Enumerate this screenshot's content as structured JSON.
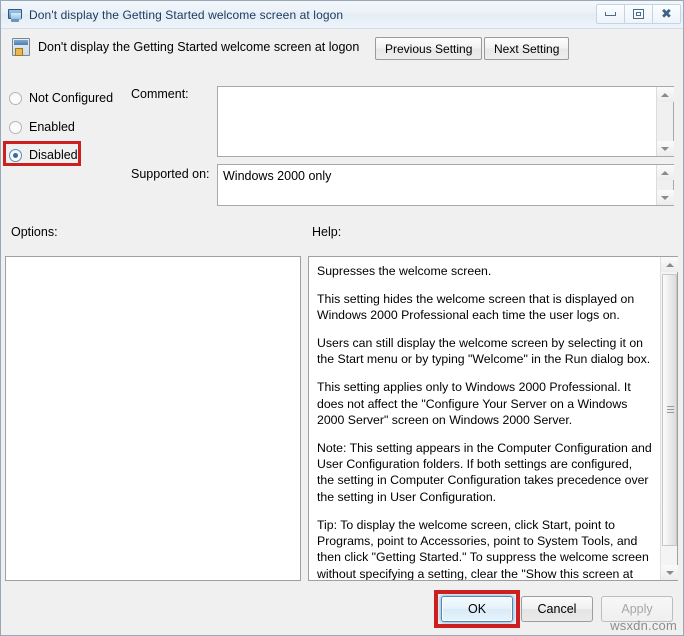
{
  "window": {
    "title": "Don't display the Getting Started welcome screen at logon",
    "title_icon": "monitor-icon",
    "controls": {
      "minimize": "minimize-icon",
      "restore": "restore-icon",
      "close": "close-icon"
    }
  },
  "header": {
    "icon": "policy-setting-icon",
    "title": "Don't display the Getting Started welcome screen at logon",
    "previous_label": "Previous Setting",
    "next_label": "Next Setting"
  },
  "state_options": [
    {
      "label": "Not Configured",
      "selected": false
    },
    {
      "label": "Enabled",
      "selected": false
    },
    {
      "label": "Disabled",
      "selected": true
    }
  ],
  "fields": {
    "comment_label": "Comment:",
    "comment_value": "",
    "supported_label": "Supported on:",
    "supported_value": "Windows 2000 only"
  },
  "panels": {
    "options_label": "Options:",
    "options_content": "",
    "help_label": "Help:",
    "help_paragraphs": [
      "Supresses the welcome screen.",
      "This setting hides the welcome screen that is displayed on Windows 2000 Professional each time the user logs on.",
      "Users can still display the welcome screen by selecting it on the Start menu or by typing \"Welcome\" in the Run dialog box.",
      "This setting applies only to Windows 2000 Professional. It does not affect the \"Configure Your Server on a Windows 2000 Server\" screen on Windows 2000 Server.",
      "Note: This setting appears in the Computer Configuration and User Configuration folders. If both settings are configured, the setting in Computer Configuration takes precedence over the setting in User Configuration.",
      "Tip: To display the welcome screen, click Start, point to Programs, point to Accessories, point to System Tools, and then click \"Getting Started.\" To suppress the welcome screen without specifying a setting, clear the \"Show this screen at startup\" check"
    ]
  },
  "footer": {
    "ok_label": "OK",
    "cancel_label": "Cancel",
    "apply_label": "Apply",
    "apply_enabled": false
  },
  "watermark": "wsxdn.com",
  "annotation_color": "#cc1f1f"
}
